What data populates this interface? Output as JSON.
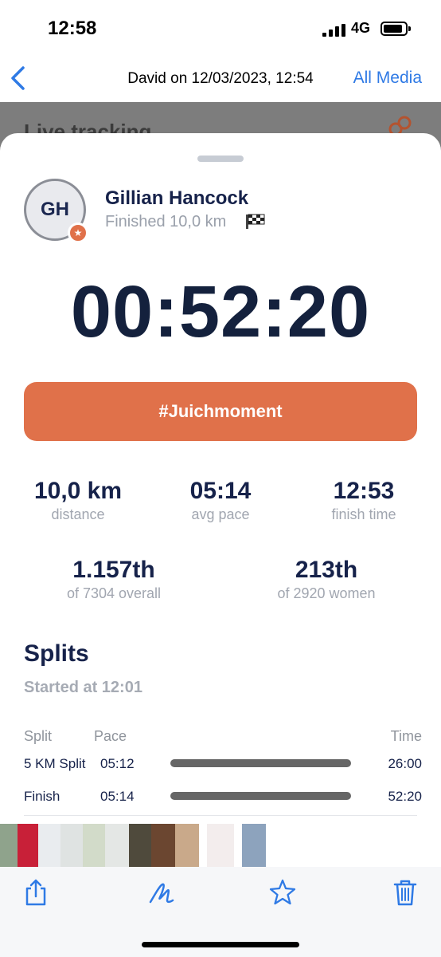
{
  "status_bar": {
    "time": "12:58",
    "network": "4G"
  },
  "nav": {
    "title": "David on 12/03/2023, 12:54",
    "right_label": "All Media",
    "back_icon": "chevron-left-icon"
  },
  "background_peek": {
    "title": "Live tracking"
  },
  "runner": {
    "initials": "GH",
    "name": "Gillian Hancock",
    "status": "Finished 10,0 km",
    "badge_icon": "star-icon",
    "status_icon": "checkered-flag-icon"
  },
  "finish_time": "00:52:20",
  "cheer_button": "#Juichmoment",
  "stats": {
    "distance": {
      "value": "10,0 km",
      "label": "distance"
    },
    "pace": {
      "value": "05:14",
      "label": "avg pace"
    },
    "finish": {
      "value": "12:53",
      "label": "finish time"
    },
    "overall": {
      "value": "1.157th",
      "label": "of 7304 overall"
    },
    "women": {
      "value": "213th",
      "label": "of 2920 women"
    }
  },
  "splits": {
    "heading": "Splits",
    "started": "Started at 12:01",
    "columns": {
      "split": "Split",
      "pace": "Pace",
      "time": "Time"
    },
    "rows": [
      {
        "name": "5 KM Split",
        "pace": "05:12",
        "time": "26:00"
      },
      {
        "name": "Finish",
        "pace": "05:14",
        "time": "52:20"
      }
    ]
  },
  "toolbar": {
    "share": "share-icon",
    "markup": "markup-icon",
    "favorite": "star-outline-icon",
    "delete": "trash-icon"
  },
  "colors": {
    "accent": "#e0714a",
    "link": "#2f7ae5",
    "ink": "#16224a",
    "muted": "#a1a6b0"
  }
}
